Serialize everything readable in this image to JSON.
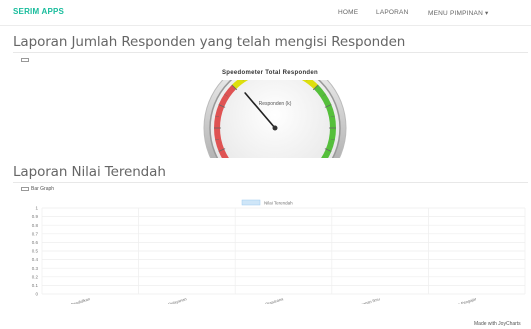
{
  "navbar": {
    "brand": "SERIM APPS",
    "links": [
      "HOME",
      "LAPORAN",
      "MENU PIMPINAN ▾"
    ]
  },
  "section1": {
    "title": "Laporan Jumlah Responden yang telah mengisi Responden",
    "label": ""
  },
  "gauge": {
    "title": "Speedometer Total Responden",
    "unit_label": "Responden (k)",
    "value": 4.2,
    "min": 0,
    "max": 12,
    "bands": [
      {
        "from": 0,
        "to": 4,
        "color": "#df5353"
      },
      {
        "from": 4,
        "to": 8,
        "color": "#dddf0d"
      },
      {
        "from": 8,
        "to": 12,
        "color": "#55bf3b"
      }
    ]
  },
  "section2": {
    "title": "Laporan Nilai Terendah",
    "label": "Bar Graph"
  },
  "chart_data": {
    "type": "bar",
    "series": [
      {
        "name": "Nilai Terendah",
        "values": [
          0,
          0,
          0,
          0,
          0
        ],
        "color": "#cfe6f8"
      }
    ],
    "categories": [
      "Kualitas Pendidikan",
      "Kualitas Pelayanan",
      "Kualitas Sarana Prasarana",
      "Kualitas Penerapan Ilmu",
      "Kualitas Tenaga Pengajar"
    ],
    "y_ticks": [
      "0",
      "0.1",
      "0.2",
      "0.3",
      "0.4",
      "0.5",
      "0.6",
      "0.7",
      "0.8",
      "0.9",
      "1"
    ],
    "ylim": [
      0,
      1
    ],
    "grid": true,
    "legend": "top"
  },
  "footer": {
    "credit": "Made with JoyCharts"
  }
}
